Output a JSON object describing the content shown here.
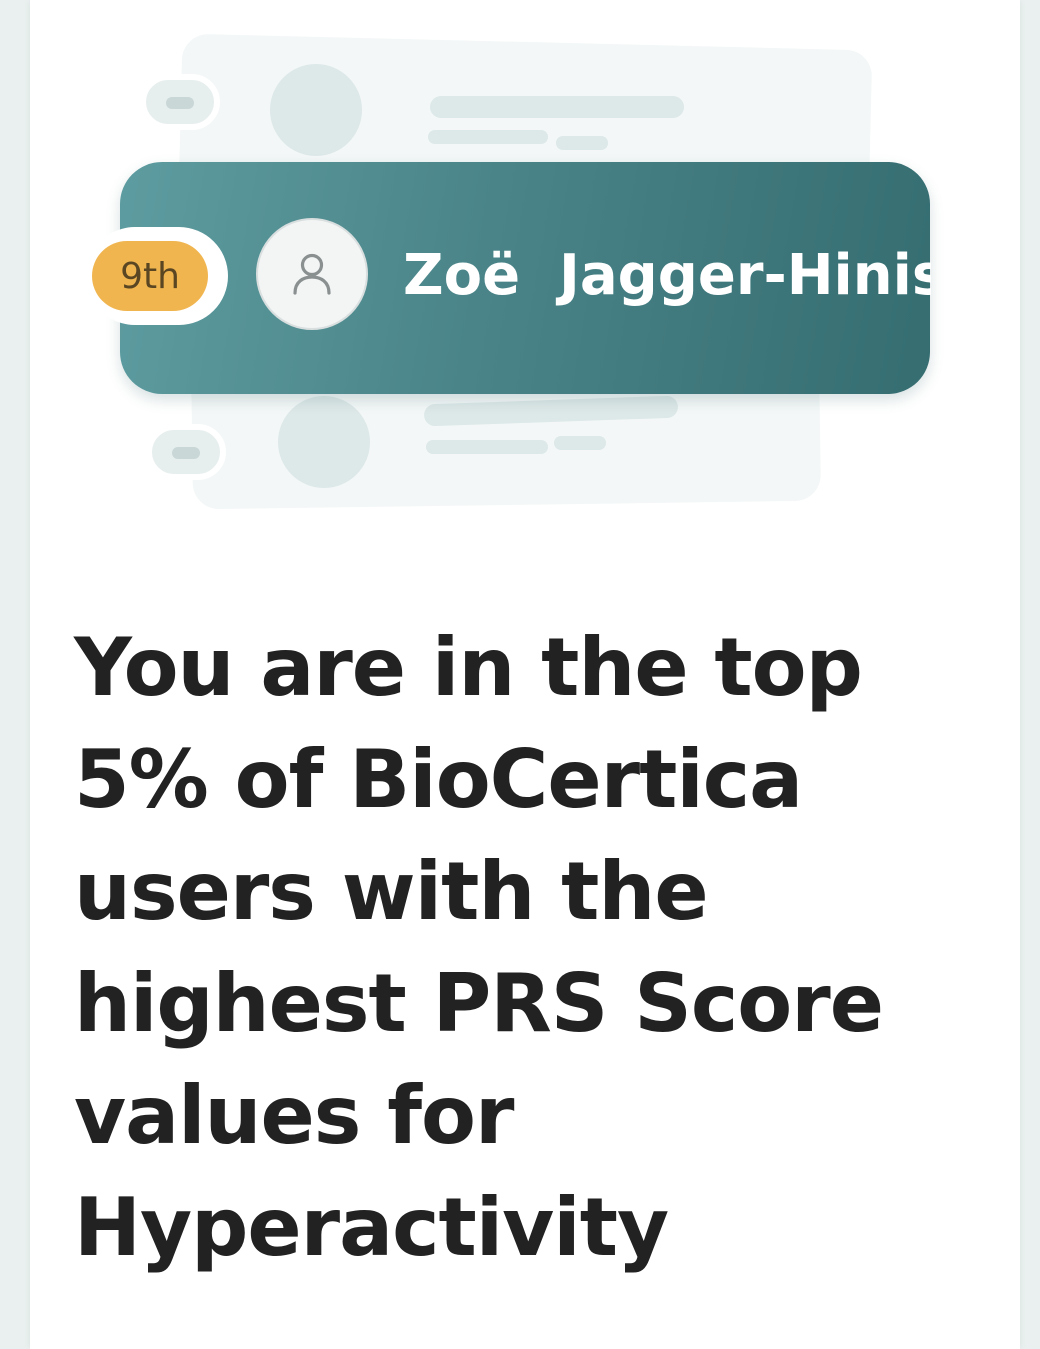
{
  "leaderboard": {
    "rank_label": "9th",
    "user_name": "Zoë  Jagger-Hinis",
    "avatar_icon": "user-icon",
    "accent_color": "#4a8488",
    "rank_badge_color": "#f0b54f"
  },
  "message": {
    "headline": "You are in the top 5% of BioCertica users with the highest PRS Score values for Hyperactivity"
  }
}
